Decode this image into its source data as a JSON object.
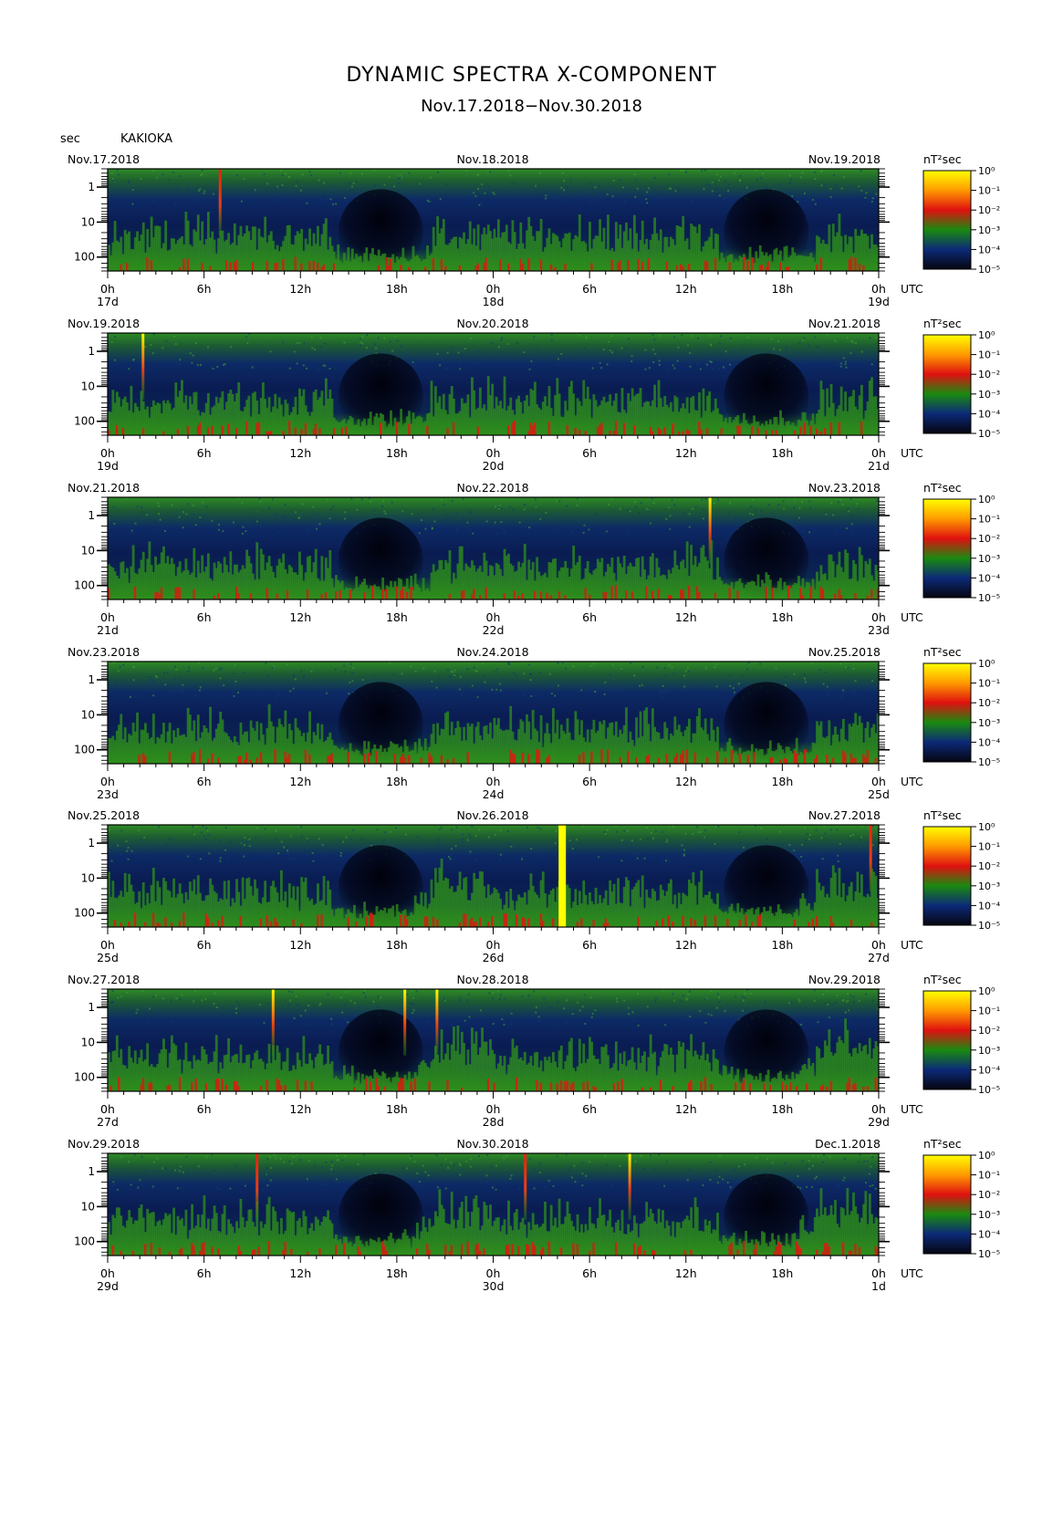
{
  "header": {
    "title": "DYNAMIC SPECTRA X-COMPONENT",
    "subtitle": "Nov.17.2018−Nov.30.2018",
    "y_unit_label": "sec",
    "station": "KAKIOKA"
  },
  "chart_data": {
    "type": "heatmap",
    "component": "X",
    "x_tick_labels": [
      "0h",
      "6h",
      "12h",
      "18h",
      "0h",
      "6h",
      "12h",
      "18h",
      "0h"
    ],
    "x_unit": "UTC",
    "y_tick_labels": [
      "1",
      "10",
      "100"
    ],
    "y_scale": "log",
    "colorbar": {
      "unit_label": "nT²sec",
      "tick_labels": [
        "10⁰",
        "10⁻¹",
        "10⁻²",
        "10⁻³",
        "10⁻⁴",
        "10⁻⁵"
      ],
      "tick_values": [
        1,
        0.1,
        0.01,
        0.001,
        0.0001,
        1e-05
      ],
      "colors": [
        "#ffff00",
        "#ff9a00",
        "#e01010",
        "#1a8a10",
        "#0c2a78",
        "#050510"
      ]
    },
    "panels": [
      {
        "date_left": "Nov.17.2018",
        "date_mid": "Nov.18.2018",
        "date_right": "Nov.19.2018",
        "day_labels": [
          "17d",
          "18d",
          "19d"
        ],
        "events": [
          {
            "hour": 7,
            "peak": "red"
          }
        ]
      },
      {
        "date_left": "Nov.19.2018",
        "date_mid": "Nov.20.2018",
        "date_right": "Nov.21.2018",
        "day_labels": [
          "19d",
          "20d",
          "21d"
        ],
        "events": [
          {
            "hour": 2.2,
            "peak": "yellow"
          }
        ]
      },
      {
        "date_left": "Nov.21.2018",
        "date_mid": "Nov.22.2018",
        "date_right": "Nov.23.2018",
        "day_labels": [
          "21d",
          "22d",
          "23d"
        ],
        "events": [
          {
            "hour": 37.5,
            "peak": "yellow"
          }
        ]
      },
      {
        "date_left": "Nov.23.2018",
        "date_mid": "Nov.24.2018",
        "date_right": "Nov.25.2018",
        "day_labels": [
          "23d",
          "24d",
          "25d"
        ],
        "events": []
      },
      {
        "date_left": "Nov.25.2018",
        "date_mid": "Nov.26.2018",
        "date_right": "Nov.27.2018",
        "day_labels": [
          "25d",
          "26d",
          "27d"
        ],
        "events": [
          {
            "hour": 28.3,
            "peak": "yellow-block"
          },
          {
            "hour": 47.5,
            "peak": "red"
          }
        ]
      },
      {
        "date_left": "Nov.27.2018",
        "date_mid": "Nov.28.2018",
        "date_right": "Nov.29.2018",
        "day_labels": [
          "27d",
          "28d",
          "29d"
        ],
        "events": [
          {
            "hour": 10.3,
            "peak": "yellow"
          },
          {
            "hour": 18.5,
            "peak": "yellow"
          },
          {
            "hour": 20.5,
            "peak": "yellow"
          }
        ]
      },
      {
        "date_left": "Nov.29.2018",
        "date_mid": "Nov.30.2018",
        "date_right": "Dec.1.2018",
        "day_labels": [
          "29d",
          "30d",
          "1d"
        ],
        "events": [
          {
            "hour": 9.3,
            "peak": "red"
          },
          {
            "hour": 26,
            "peak": "red"
          },
          {
            "hour": 32.5,
            "peak": "yellow"
          }
        ]
      }
    ]
  }
}
